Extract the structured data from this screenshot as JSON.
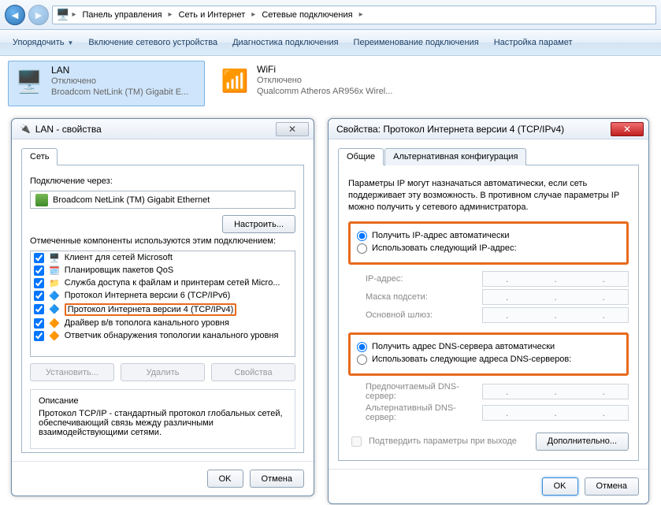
{
  "breadcrumb": {
    "items": [
      "Панель управления",
      "Сеть и Интернет",
      "Сетевые подключения"
    ]
  },
  "toolbar": {
    "organize": "Упорядочить",
    "disable": "Включение сетевого устройства",
    "diagnose": "Диагностика подключения",
    "rename": "Переименование подключения",
    "settings": "Настройка парамет"
  },
  "connections": [
    {
      "name": "LAN",
      "status": "Отключено",
      "device": "Broadcom NetLink (TM) Gigabit E..."
    },
    {
      "name": "WiFi",
      "status": "Отключено",
      "device": "Qualcomm Atheros AR956x Wirel..."
    }
  ],
  "lan_dialog": {
    "title": "LAN - свойства",
    "tab_network": "Сеть",
    "connect_via_label": "Подключение через:",
    "connect_via_value": "Broadcom NetLink (TM) Gigabit Ethernet",
    "configure_btn": "Настроить...",
    "components_label": "Отмеченные компоненты используются этим подключением:",
    "components": [
      "Клиент для сетей Microsoft",
      "Планировщик пакетов QoS",
      "Служба доступа к файлам и принтерам сетей Micro...",
      "Протокол Интернета версии 6 (TCP/IPv6)",
      "Протокол Интернета версии 4 (TCP/IPv4)",
      "Драйвер в/в тополога канального уровня",
      "Ответчик обнаружения топологии канального уровня"
    ],
    "install_btn": "Установить...",
    "uninstall_btn": "Удалить",
    "properties_btn": "Свойства",
    "desc_title": "Описание",
    "desc_text": "Протокол TCP/IP - стандартный протокол глобальных сетей, обеспечивающий связь между различными взаимодействующими сетями.",
    "ok_btn": "OK",
    "cancel_btn": "Отмена"
  },
  "ip_dialog": {
    "title": "Свойства: Протокол Интернета версии 4 (TCP/IPv4)",
    "tab_general": "Общие",
    "tab_alt": "Альтернативная конфигурация",
    "info": "Параметры IP могут назначаться автоматически, если сеть поддерживает эту возможность. В противном случае параметры IP можно получить у сетевого администратора.",
    "radio_auto_ip": "Получить IP-адрес автоматически",
    "radio_manual_ip": "Использовать следующий IP-адрес:",
    "field_ip": "IP-адрес:",
    "field_mask": "Маска подсети:",
    "field_gw": "Основной шлюз:",
    "radio_auto_dns": "Получить адрес DNS-сервера автоматически",
    "radio_manual_dns": "Использовать следующие адреса DNS-серверов:",
    "field_dns1": "Предпочитаемый DNS-сервер:",
    "field_dns2": "Альтернативный DNS-сервер:",
    "check_validate": "Подтвердить параметры при выходе",
    "advanced_btn": "Дополнительно...",
    "ok_btn": "OK",
    "cancel_btn": "Отмена"
  }
}
